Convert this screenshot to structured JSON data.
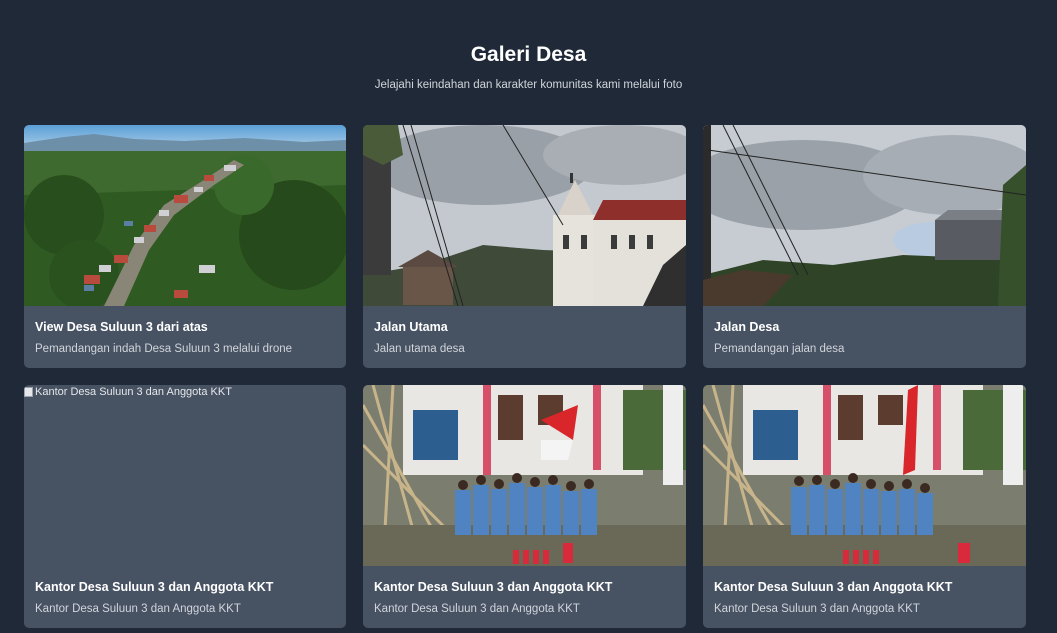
{
  "gallery": {
    "title": "Galeri Desa",
    "subtitle": "Jelajahi keindahan dan karakter komunitas kami melalui foto",
    "items": [
      {
        "title": "View Desa Suluun 3 dari atas",
        "description": "Pemandangan indah Desa Suluun 3 melalui drone",
        "image": "aerial-village"
      },
      {
        "title": "Jalan Utama",
        "description": "Jalan utama desa",
        "image": "church-street"
      },
      {
        "title": "Jalan Desa",
        "description": "Pemandangan jalan desa",
        "image": "village-road"
      },
      {
        "title": "Kantor Desa Suluun 3 dan Anggota KKT",
        "description": "Kantor Desa Suluun 3 dan Anggota KKT",
        "image": "broken",
        "alt": "Kantor Desa Suluun 3 dan Anggota KKT"
      },
      {
        "title": "Kantor Desa Suluun 3 dan Anggota KKT",
        "description": "Kantor Desa Suluun 3 dan Anggota KKT",
        "image": "group-photo"
      },
      {
        "title": "Kantor Desa Suluun 3 dan Anggota KKT",
        "description": "Kantor Desa Suluun 3 dan Anggota KKT",
        "image": "group-photo"
      }
    ]
  }
}
